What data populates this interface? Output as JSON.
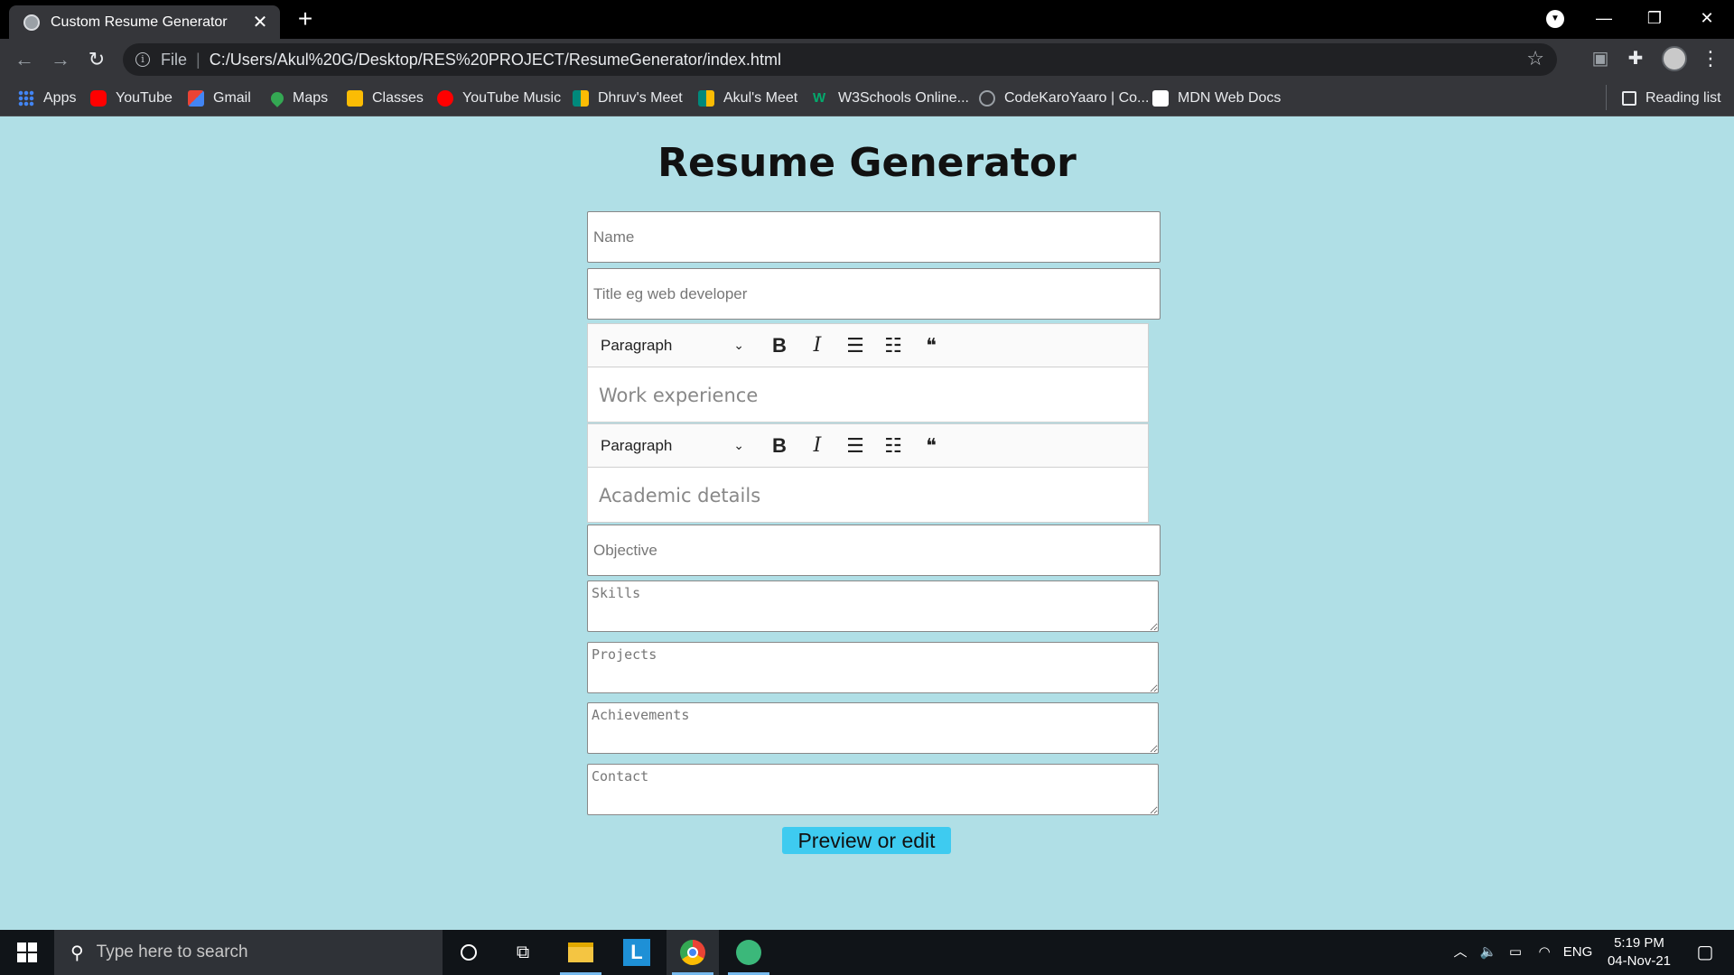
{
  "browser": {
    "tab_title": "Custom Resume Generator",
    "tab_close": "✕",
    "new_tab": "+",
    "url_scheme": "File",
    "url": "C:/Users/Akul%20G/Desktop/RES%20PROJECT/ResumeGenerator/index.html",
    "bookmarks": [
      {
        "label": "Apps",
        "color": "#4285f4"
      },
      {
        "label": "YouTube",
        "color": "#ff0000"
      },
      {
        "label": "Gmail",
        "color": "#ea4335"
      },
      {
        "label": "Maps",
        "color": "#34a853"
      },
      {
        "label": "Classes",
        "color": "#fbbc04"
      },
      {
        "label": "YouTube Music",
        "color": "#ff0000"
      },
      {
        "label": "Dhruv's Meet",
        "color": "#00897b"
      },
      {
        "label": "Akul's Meet",
        "color": "#00897b"
      },
      {
        "label": "W3Schools Online...",
        "color": "#04aa6d"
      },
      {
        "label": "CodeKaroYaaro | Co...",
        "color": "#9aa0a6"
      },
      {
        "label": "MDN Web Docs",
        "color": "#ffffff"
      }
    ],
    "reading_list": "Reading list"
  },
  "page": {
    "title": "Resume Generator",
    "name_placeholder": "Name",
    "title_placeholder": "Title eg web developer",
    "editors": [
      {
        "block_format": "Paragraph",
        "placeholder": "Work experience"
      },
      {
        "block_format": "Paragraph",
        "placeholder": "Academic details"
      }
    ],
    "objective_placeholder": "Objective",
    "skills_placeholder": "Skills",
    "projects_placeholder": "Projects",
    "achievements_placeholder": "Achievements",
    "contact_placeholder": "Contact",
    "preview_button": "Preview or edit"
  },
  "taskbar": {
    "search_placeholder": "Type here to search",
    "language": "ENG",
    "time": "5:19 PM",
    "date": "04-Nov-21"
  }
}
